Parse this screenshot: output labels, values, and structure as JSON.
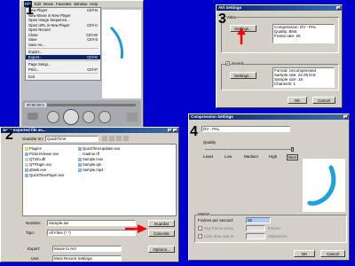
{
  "player": {
    "menubar": [
      "File",
      "Edit",
      "Movie",
      "Favorites",
      "Window",
      "Help"
    ],
    "menu_items": [
      {
        "label": "New Player",
        "shortcut": "Ctrl+N"
      },
      {
        "label": "New Movie in New Player",
        "shortcut": ""
      },
      {
        "label": "Open Image Sequence...",
        "shortcut": ""
      },
      {
        "label": "Open URL in New Player",
        "shortcut": "Ctrl+U"
      },
      {
        "label": "Open Recent",
        "shortcut": ""
      },
      {
        "label": "Close",
        "shortcut": "Ctrl+W"
      },
      {
        "label": "Save",
        "shortcut": "Ctrl+S"
      },
      {
        "label": "Save As...",
        "shortcut": ""
      },
      {
        "label": "Import...",
        "shortcut": ""
      },
      {
        "label": "Export...",
        "shortcut": "Ctrl+E"
      },
      {
        "label": "Page Setup...",
        "shortcut": ""
      },
      {
        "label": "Print...",
        "shortcut": "Ctrl+P"
      },
      {
        "label": "Exit",
        "shortcut": ""
      }
    ],
    "timecode": "00:00:00:0"
  },
  "export_dialog": {
    "title": "Save exported file as...",
    "folder_label": "Guardar en:",
    "folder_value": "QuickTime",
    "files_col1": [
      "Plugins",
      "PictureViewer.exe",
      "QTInfo.dll",
      "QTPlugin.ocx",
      "qttask.exe",
      "QuickTimePlayer.exe"
    ],
    "files_col2": [
      "QuickTimeUpdater.exe",
      "readme.rtf",
      "Sample.mov",
      "Sample.qtx",
      "Sample.mp4"
    ],
    "name_label": "Nombre:",
    "name_value": "Sample.avi",
    "type_label": "Tipo:",
    "type_value": "All Files (*.*)",
    "save_button": "Guardar",
    "cancel_button": "Cancelar",
    "export_label": "Export:",
    "export_value": "Movie to AVI",
    "use_label": "Use:",
    "use_value": "Most Recent Settings",
    "options_button": "Options..."
  },
  "avi_settings": {
    "title": "AVI Settings",
    "video_label": "Video",
    "video_settings_button": "Settings...",
    "video_info": [
      "Compression: DV - PAL",
      "Quality: Best",
      "Frame rate: 25"
    ],
    "sound_label": "Sound",
    "sound_checked": "✔",
    "sound_settings_button": "Settings...",
    "sound_info": [
      "Format: Uncompressed",
      "Sample rate: 22.05 kHz",
      "Sample size: 16",
      "Channels: 1"
    ],
    "ok_button": "OK",
    "cancel_button": "Cancel"
  },
  "compression": {
    "title": "Compression Settings",
    "codec_value": "DV - PAL",
    "quality_label": "Quality",
    "quality_ticks": [
      "Least",
      "Low",
      "Medium",
      "High",
      "Best"
    ],
    "quality_level": 1.0,
    "motion_label": "Motion",
    "fps_label": "Frames per second:",
    "fps_value": "25",
    "keyframe_label": "Key frame every",
    "keyframe_unit": "frames",
    "limit_label": "Limit data rate to",
    "limit_unit": "KBytes/sec",
    "ok_button": "OK",
    "cancel_button": "Cancel"
  },
  "steps": [
    "1",
    "2",
    "3",
    "4"
  ],
  "colors": {
    "arrow": "#ff0000",
    "desktop": "#0000cc",
    "accent": "#0a246a"
  }
}
